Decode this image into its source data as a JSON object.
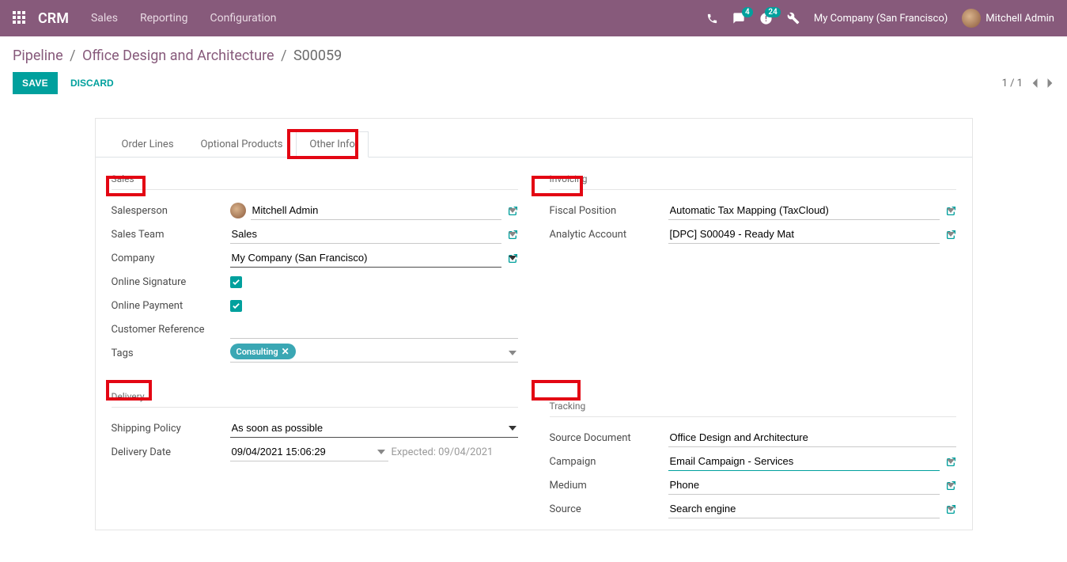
{
  "topbar": {
    "brand": "CRM",
    "menu": [
      "Sales",
      "Reporting",
      "Configuration"
    ],
    "chat_badge": "4",
    "activity_badge": "24",
    "company": "My Company (San Francisco)",
    "user": "Mitchell Admin"
  },
  "breadcrumb": {
    "a": "Pipeline",
    "b": "Office Design and Architecture",
    "c": "S00059"
  },
  "actions": {
    "save": "SAVE",
    "discard": "DISCARD"
  },
  "pager": {
    "text": "1 / 1"
  },
  "tabs": [
    "Order Lines",
    "Optional Products",
    "Other Info"
  ],
  "sections": {
    "sales": {
      "title": "Sales",
      "salesperson_lbl": "Salesperson",
      "salesperson_val": "Mitchell Admin",
      "team_lbl": "Sales Team",
      "team_val": "Sales",
      "company_lbl": "Company",
      "company_val": "My Company (San Francisco)",
      "sig_lbl": "Online Signature",
      "pay_lbl": "Online Payment",
      "ref_lbl": "Customer Reference",
      "tags_lbl": "Tags",
      "tag_val": "Consulting"
    },
    "delivery": {
      "title": "Delivery",
      "policy_lbl": "Shipping Policy",
      "policy_val": "As soon as possible",
      "date_lbl": "Delivery Date",
      "date_val": "09/04/2021 15:06:29",
      "expected": "Expected: 09/04/2021"
    },
    "invoicing": {
      "title": "Invoicing",
      "fiscal_lbl": "Fiscal Position",
      "fiscal_val": "Automatic Tax Mapping (TaxCloud)",
      "analytic_lbl": "Analytic Account",
      "analytic_val": "[DPC] S00049 - Ready Mat"
    },
    "tracking": {
      "title": "Tracking",
      "source_doc_lbl": "Source Document",
      "source_doc_val": "Office Design and Architecture",
      "campaign_lbl": "Campaign",
      "campaign_val": "Email Campaign - Services",
      "medium_lbl": "Medium",
      "medium_val": "Phone",
      "source_lbl": "Source",
      "source_val": "Search engine"
    }
  }
}
